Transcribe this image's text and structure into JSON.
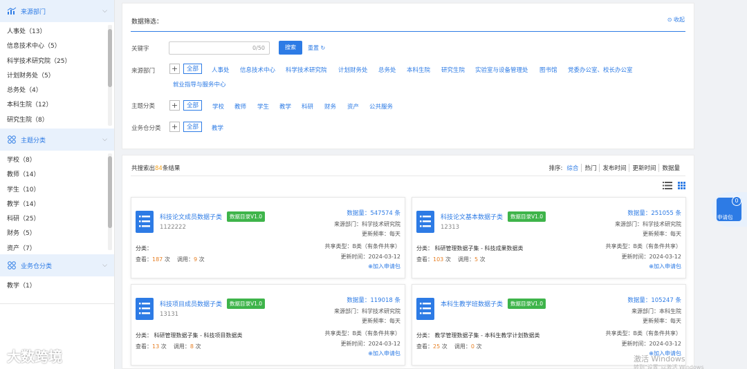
{
  "colors": {
    "accent": "#2d7be5",
    "badge_green": "#3eb44a",
    "orange": "#e67e22"
  },
  "sidebar": {
    "source_dept": {
      "title": "来源部门",
      "items": [
        "人事处（13）",
        "信息技术中心（5）",
        "科学技术研究院（25）",
        "计划财务处（5）",
        "总务处（4）",
        "本科生院（12）",
        "研究生院（8）"
      ]
    },
    "topic": {
      "title": "主题分类",
      "items": [
        "学校（8）",
        "教师（14）",
        "学生（10）",
        "教学（14）",
        "科研（25）",
        "财务（5）",
        "资产（7）"
      ]
    },
    "business": {
      "title": "业务仓分类",
      "items": [
        "教学（1）"
      ]
    }
  },
  "filter": {
    "title": "数据筛选：",
    "collapse": "收起",
    "keyword_label": "关键字",
    "keyword_count": "0/50",
    "search_btn": "搜索",
    "reset_btn": "重置",
    "dept_label": "来源部门",
    "topic_label": "主题分类",
    "biz_label": "业务仓分类",
    "all": "全部",
    "dept_tags": [
      "人事处",
      "信息技术中心",
      "科学技术研究院",
      "计划财务处",
      "总务处",
      "本科生院",
      "研究生院",
      "实验室与设备管理处",
      "图书馆",
      "党委办公室、校长办公室"
    ],
    "dept_tags_row2": [
      "就业指导与服务中心"
    ],
    "topic_tags": [
      "学校",
      "教师",
      "学生",
      "教学",
      "科研",
      "财务",
      "资产",
      "公共服务"
    ],
    "biz_tags": [
      "教学"
    ]
  },
  "results": {
    "count_prefix": "共搜索出",
    "count": "84",
    "count_suffix": "条结果",
    "sort_label": "排序:",
    "sort_options": [
      "综合",
      "热门",
      "发布时间",
      "更新时间",
      "数据量"
    ],
    "cards": [
      {
        "title": "科技论文成员数据子类",
        "badge": "数据目录V1.0",
        "code": "1122222",
        "data_count": "数据量：547574 条",
        "source": "来源部门：科学技术研究院",
        "freq": "更新频率：每天",
        "category": "分类：",
        "share": "共享类型：B类（有条件共享）",
        "views": "187",
        "calls": "9",
        "update": "更新时间：2024-03-12",
        "add": "加入申请包"
      },
      {
        "title": "科技论文基本数据子类",
        "badge": "数据目录V1.0",
        "code": "12313",
        "data_count": "数据量：251055 条",
        "source": "来源部门：科学技术研究院",
        "freq": "更新频率：每天",
        "category": "分类：  科研管理数据子集 - 科技成果数据类",
        "share": "共享类型：B类（有条件共享）",
        "views": "103",
        "calls": "5",
        "update": "更新时间：2024-03-12",
        "add": "加入申请包"
      },
      {
        "title": "科技项目成员数据子类",
        "badge": "数据目录V1.0",
        "code": "13131",
        "data_count": "数据量：119018 条",
        "source": "来源部门：科学技术研究院",
        "freq": "更新频率：每天",
        "category": "分类：  科研管理数据子集 - 科技项目数据类",
        "share": "共享类型：B类（有条件共享）",
        "views": "13",
        "calls": "8",
        "update": "更新时间：2024-03-12",
        "add": "加入申请包"
      },
      {
        "title": "本科生教学班数据子类",
        "badge": "数据目录V1.0",
        "code": "",
        "data_count": "数据量：105247 条",
        "source": "来源部门：本科生院",
        "freq": "更新频率：每天",
        "category": "分类：  教学管理数据子集 - 本科生教学计划数据类",
        "share": "共享类型：B类（有条件共享）",
        "views": "25",
        "calls": "0",
        "update": "更新时间：2024-03-12",
        "add": "加入申请包"
      }
    ],
    "view_label": "查看：",
    "call_label": "调用：",
    "unit": "次"
  },
  "apply_pkg": {
    "count": "0",
    "label": "申请包"
  },
  "watermark": "大数跨境",
  "windows": {
    "line1": "激活 Windows",
    "line2": "转到\"设置\"以激活 Windows"
  }
}
